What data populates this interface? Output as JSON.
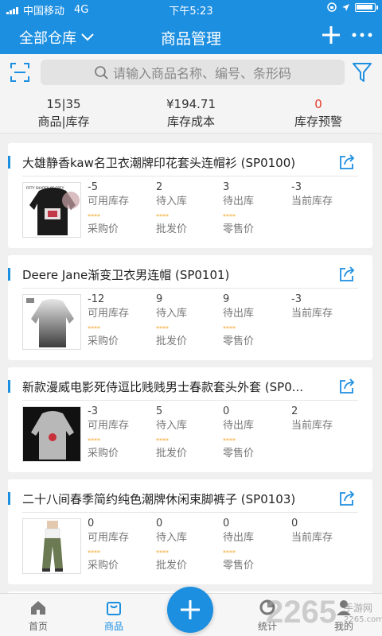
{
  "status": {
    "carrier": "中国移动",
    "network": "4G",
    "time": "下午5:23"
  },
  "header": {
    "warehouse": "全部仓库",
    "title": "商品管理"
  },
  "search": {
    "placeholder": "请输入商品名称、编号、条形码"
  },
  "summary": [
    {
      "value": "15|35",
      "label": "商品|库存"
    },
    {
      "value": "¥194.71",
      "label": "库存成本"
    },
    {
      "value": "0",
      "label": "库存预警"
    }
  ],
  "labels": {
    "available": "可用库存",
    "incoming": "待入库",
    "outgoing": "待出库",
    "current": "当前库存",
    "purchase": "采购价",
    "wholesale": "批发价",
    "retail": "零售价",
    "masked": "****"
  },
  "products": [
    {
      "name": "大雄静香kaw名卫衣潮牌印花套头连帽衫 (SP0100)",
      "available": "-5",
      "incoming": "2",
      "outgoing": "3",
      "current": "-3",
      "thumb_caption": "FIFTY SHADES OF GREY"
    },
    {
      "name": "Deere Jane渐变卫衣男连帽 (SP0101)",
      "available": "-12",
      "incoming": "9",
      "outgoing": "9",
      "current": "-3"
    },
    {
      "name": "新款漫威电影死侍逗比贱贱男士春款套头外套 (SP0...",
      "available": "-3",
      "incoming": "5",
      "outgoing": "0",
      "current": "2"
    },
    {
      "name": "二十八间春季简约纯色潮牌休闲束脚裤子 (SP0103)",
      "available": "0",
      "incoming": "0",
      "outgoing": "0",
      "current": "0"
    }
  ],
  "tabs": [
    {
      "label": "首页",
      "icon": "home-icon"
    },
    {
      "label": "商品",
      "icon": "bag-icon"
    },
    {
      "label": "统计",
      "icon": "chart-icon"
    },
    {
      "label": "我的",
      "icon": "user-icon"
    }
  ],
  "watermark": {
    "number": "2265",
    "text": "手游网",
    "url": "2265.com"
  },
  "colors": {
    "primary": "#1d8fe1",
    "warning": "#e53b2c",
    "star": "#f2a325"
  }
}
